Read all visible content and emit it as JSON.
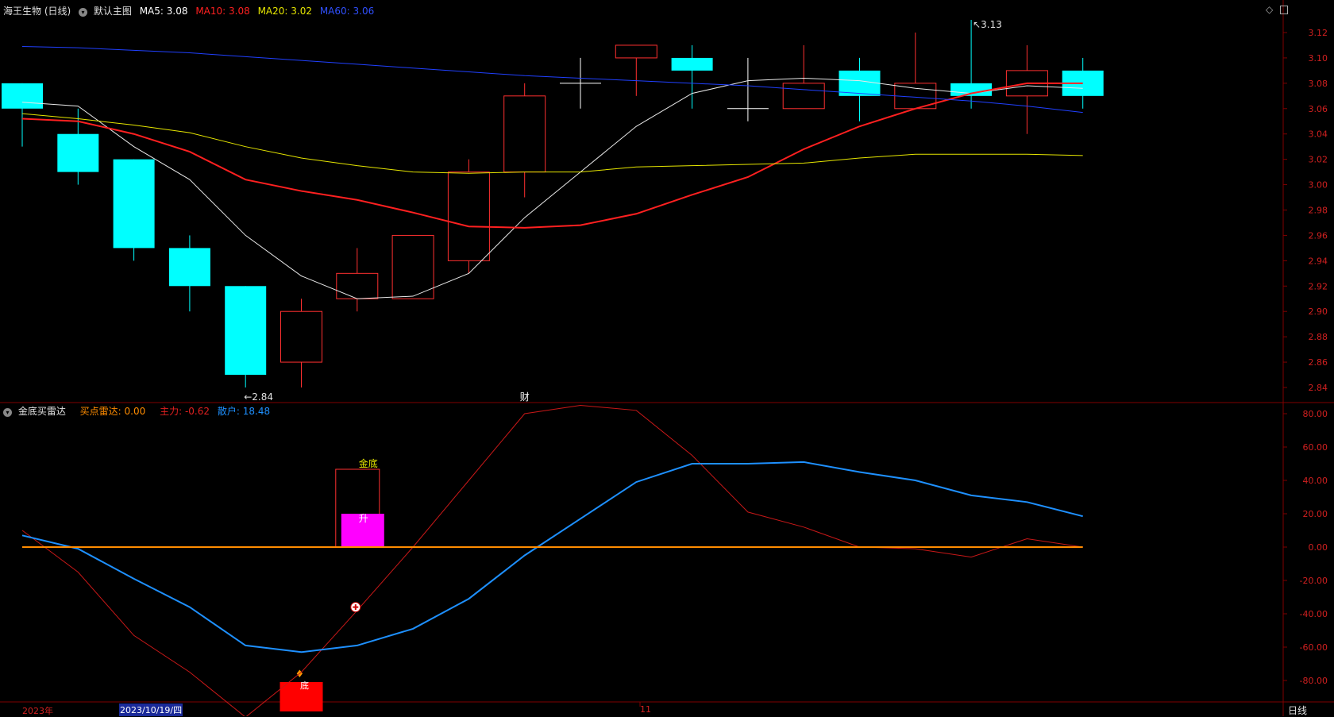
{
  "main_header": {
    "stock_name": "海王生物 (日线)",
    "template_name": "默认主图",
    "ma5": {
      "label": "MA5:",
      "value": "3.08",
      "color": "#ffffff"
    },
    "ma10": {
      "label": "MA10:",
      "value": "3.08",
      "color": "#ff2020"
    },
    "ma20": {
      "label": "MA20:",
      "value": "3.02",
      "color": "#e6e600"
    },
    "ma60": {
      "label": "MA60:",
      "value": "3.06",
      "color": "#3050ff"
    }
  },
  "sub_header": {
    "indicator_name": "金底买雷达",
    "buy_radar": {
      "label": "买点雷达:",
      "value": "0.00",
      "color": "#ff8c00"
    },
    "main_force": {
      "label": "主力:",
      "value": "-0.62",
      "color": "#e02020"
    },
    "retail": {
      "label": "散户:",
      "value": "18.48",
      "color": "#1e90ff"
    }
  },
  "bottom_bar": {
    "year_label": "2023年",
    "cursor_date": "2023/10/19/四",
    "month_label": "11",
    "period_button": "日线"
  },
  "colors": {
    "up": "#ff3030",
    "down": "#00ffff",
    "cross": "#ffffff",
    "grid": "#800000",
    "axis_text": "#d02020"
  },
  "chart_data": [
    {
      "type": "candlestick",
      "title": "海王生物 (日线)",
      "ylim": [
        2.83,
        3.14
      ],
      "yticks": [
        "3.12",
        "3.10",
        "3.08",
        "3.06",
        "3.04",
        "3.02",
        "3.00",
        "2.98",
        "2.96",
        "2.94",
        "2.92",
        "2.90",
        "2.88",
        "2.86",
        "2.84"
      ],
      "candles": [
        {
          "o": 3.08,
          "h": 3.08,
          "l": 3.03,
          "c": 3.06
        },
        {
          "o": 3.04,
          "h": 3.06,
          "l": 3.0,
          "c": 3.01
        },
        {
          "o": 3.02,
          "h": 3.02,
          "l": 2.94,
          "c": 2.95
        },
        {
          "o": 2.95,
          "h": 2.96,
          "l": 2.9,
          "c": 2.92
        },
        {
          "o": 2.92,
          "h": 2.92,
          "l": 2.84,
          "c": 2.85
        },
        {
          "o": 2.86,
          "h": 2.91,
          "l": 2.84,
          "c": 2.9
        },
        {
          "o": 2.91,
          "h": 2.95,
          "l": 2.9,
          "c": 2.93
        },
        {
          "o": 2.91,
          "h": 2.96,
          "l": 2.91,
          "c": 2.96
        },
        {
          "o": 2.94,
          "h": 3.02,
          "l": 2.93,
          "c": 3.01
        },
        {
          "o": 3.01,
          "h": 3.08,
          "l": 2.99,
          "c": 3.07
        },
        {
          "o": 3.08,
          "h": 3.1,
          "l": 3.06,
          "c": 3.08
        },
        {
          "o": 3.1,
          "h": 3.11,
          "l": 3.07,
          "c": 3.11
        },
        {
          "o": 3.1,
          "h": 3.11,
          "l": 3.06,
          "c": 3.09
        },
        {
          "o": 3.06,
          "h": 3.1,
          "l": 3.05,
          "c": 3.06
        },
        {
          "o": 3.06,
          "h": 3.11,
          "l": 3.06,
          "c": 3.08
        },
        {
          "o": 3.09,
          "h": 3.1,
          "l": 3.05,
          "c": 3.07
        },
        {
          "o": 3.06,
          "h": 3.12,
          "l": 3.06,
          "c": 3.08
        },
        {
          "o": 3.08,
          "h": 3.13,
          "l": 3.06,
          "c": 3.07
        },
        {
          "o": 3.07,
          "h": 3.11,
          "l": 3.04,
          "c": 3.09
        },
        {
          "o": 3.09,
          "h": 3.1,
          "l": 3.06,
          "c": 3.07
        }
      ],
      "series": [
        {
          "name": "MA5",
          "color": "#e8e8e8",
          "values": [
            3.065,
            3.062,
            3.03,
            3.004,
            2.96,
            2.928,
            2.91,
            2.912,
            2.93,
            2.974,
            3.01,
            3.046,
            3.072,
            3.082,
            3.084,
            3.082,
            3.076,
            3.072,
            3.078,
            3.076
          ]
        },
        {
          "name": "MA10",
          "color": "#ff2020",
          "values": [
            3.052,
            3.05,
            3.04,
            3.026,
            3.004,
            2.995,
            2.988,
            2.978,
            2.967,
            2.966,
            2.968,
            2.977,
            2.992,
            3.006,
            3.028,
            3.046,
            3.06,
            3.072,
            3.08,
            3.08
          ]
        },
        {
          "name": "MA20",
          "color": "#e6e600",
          "values": [
            3.056,
            3.052,
            3.047,
            3.041,
            3.03,
            3.021,
            3.015,
            3.01,
            3.009,
            3.01,
            3.01,
            3.014,
            3.015,
            3.016,
            3.017,
            3.021,
            3.024,
            3.024,
            3.024,
            3.023
          ]
        },
        {
          "name": "MA60",
          "color": "#2040ff",
          "values": [
            3.109,
            3.108,
            3.106,
            3.104,
            3.101,
            3.098,
            3.095,
            3.092,
            3.089,
            3.086,
            3.084,
            3.082,
            3.08,
            3.078,
            3.075,
            3.072,
            3.069,
            3.066,
            3.062,
            3.057
          ]
        }
      ],
      "annotations": [
        {
          "text": "2.84",
          "candle": 4,
          "value": 2.84,
          "side": "low"
        },
        {
          "text": "3.13",
          "candle": 17,
          "value": 3.13,
          "side": "high"
        },
        {
          "text": "财",
          "candle": 9,
          "side": "bottom"
        }
      ]
    },
    {
      "type": "line",
      "title": "金底买雷达",
      "ylim": [
        -100,
        95
      ],
      "yticks": [
        "80.00",
        "60.00",
        "40.00",
        "20.00",
        "0.00",
        "-20.00",
        "-40.00",
        "-60.00",
        "-80.00"
      ],
      "series": [
        {
          "name": "主力",
          "color": "#c81818",
          "values": [
            10,
            -15,
            -53,
            -75,
            -102,
            -75,
            -38,
            0,
            40,
            80,
            85,
            82,
            55,
            21,
            12,
            0,
            -1,
            -6,
            5,
            0
          ]
        },
        {
          "name": "散户",
          "color": "#1e90ff",
          "values": [
            7,
            -1,
            -19,
            -36,
            -59,
            -63,
            -59,
            -49,
            -31,
            -5,
            17,
            39,
            50,
            50,
            51,
            45,
            40,
            31,
            27,
            18.48
          ]
        },
        {
          "name": "买点雷达",
          "color": "#ff8c00",
          "values": [
            0,
            0,
            0,
            0,
            0,
            0,
            0,
            0,
            0,
            0,
            0,
            0,
            0,
            0,
            0,
            0,
            0,
            0,
            0,
            0
          ]
        }
      ],
      "annotations": [
        {
          "text": "金底",
          "candle": 6,
          "value": 50,
          "kind": "box"
        },
        {
          "text": "升",
          "candle": 6,
          "value": 20,
          "kind": "bar"
        },
        {
          "text": "底",
          "candle": 5,
          "value": -80,
          "kind": "bar"
        }
      ]
    }
  ]
}
